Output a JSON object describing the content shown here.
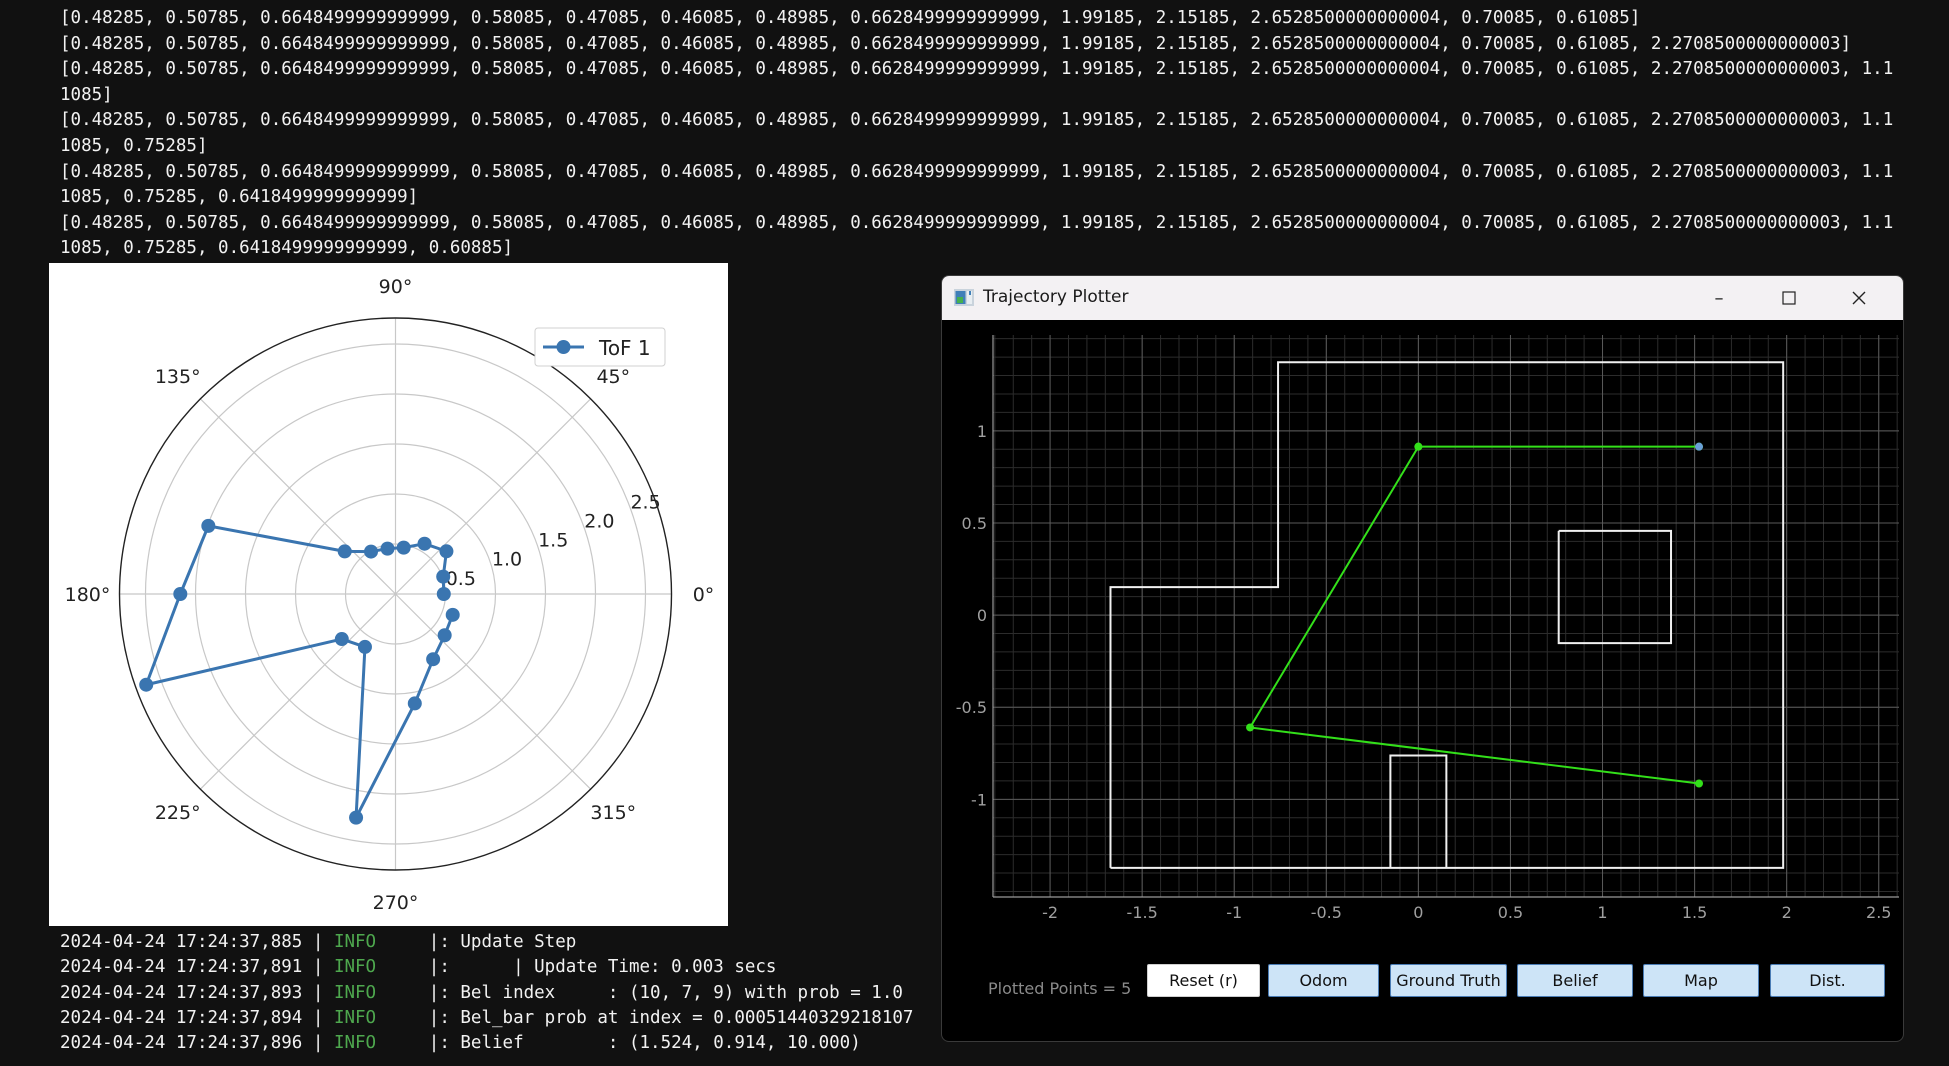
{
  "terminal": {
    "array_lines": [
      "[0.48285, 0.50785, 0.6648499999999999, 0.58085, 0.47085, 0.46085, 0.48985, 0.6628499999999999, 1.99185, 2.15185, 2.6528500000000004, 0.70085, 0.61085]",
      "[0.48285, 0.50785, 0.6648499999999999, 0.58085, 0.47085, 0.46085, 0.48985, 0.6628499999999999, 1.99185, 2.15185, 2.6528500000000004, 0.70085, 0.61085, 2.2708500000000003]",
      "[0.48285, 0.50785, 0.6648499999999999, 0.58085, 0.47085, 0.46085, 0.48985, 0.6628499999999999, 1.99185, 2.15185, 2.6528500000000004, 0.70085, 0.61085, 2.2708500000000003, 1.1",
      "1085]",
      "[0.48285, 0.50785, 0.6648499999999999, 0.58085, 0.47085, 0.46085, 0.48985, 0.6628499999999999, 1.99185, 2.15185, 2.6528500000000004, 0.70085, 0.61085, 2.2708500000000003, 1.1",
      "1085, 0.75285]",
      "[0.48285, 0.50785, 0.6648499999999999, 0.58085, 0.47085, 0.46085, 0.48985, 0.6628499999999999, 1.99185, 2.15185, 2.6528500000000004, 0.70085, 0.61085, 2.2708500000000003, 1.1",
      "1085, 0.75285, 0.6418499999999999]",
      "[0.48285, 0.50785, 0.6648499999999999, 0.58085, 0.47085, 0.46085, 0.48985, 0.6628499999999999, 1.99185, 2.15185, 2.6528500000000004, 0.70085, 0.61085, 2.2708500000000003, 1.1",
      "1085, 0.75285, 0.6418499999999999, 0.60885]"
    ],
    "log": [
      {
        "timestamp": "2024-04-24 17:24:37,885",
        "level": "INFO",
        "message": ": Update Step"
      },
      {
        "timestamp": "2024-04-24 17:24:37,891",
        "level": "INFO",
        "message": ":      | Update Time: 0.003 secs"
      },
      {
        "timestamp": "2024-04-24 17:24:37,893",
        "level": "INFO",
        "message": ": Bel index     : (10, 7, 9) with prob = 1.0"
      },
      {
        "timestamp": "2024-04-24 17:24:37,894",
        "level": "INFO",
        "message": ": Bel_bar prob at index = 0.00051440329218107"
      },
      {
        "timestamp": "2024-04-24 17:24:37,896",
        "level": "INFO",
        "message": ": Belief        : (1.524, 0.914, 10.000)"
      }
    ],
    "colors": {
      "level_info": "#4ea84e",
      "text": "#f2f2f2",
      "background": "#111111"
    }
  },
  "chart_data": [
    {
      "type": "line",
      "projection": "polar",
      "title": "",
      "legend": {
        "entries": [
          "ToF 1"
        ],
        "placement": "top-right"
      },
      "series": [
        {
          "name": "ToF 1",
          "color": "#3a75b0",
          "marker": "circle",
          "theta_deg": [
            0,
            20,
            40,
            60,
            80,
            100,
            120,
            140,
            160,
            180,
            200,
            220,
            240,
            260,
            280,
            300,
            320,
            340
          ],
          "r": [
            0.48285,
            0.50785,
            0.66485,
            0.58085,
            0.47085,
            0.46085,
            0.48985,
            0.66285,
            1.99185,
            2.15185,
            2.65285,
            0.70085,
            0.61085,
            2.27085,
            1.11085,
            0.75285,
            0.64185,
            0.60885
          ]
        }
      ],
      "theta_tick_labels": [
        "0°",
        "45°",
        "90°",
        "135°",
        "180°",
        "225°",
        "270°",
        "315°"
      ],
      "theta_ticks_deg": [
        0,
        45,
        90,
        135,
        180,
        225,
        270,
        315
      ],
      "r_ticks": [
        0.5,
        1.0,
        1.5,
        2.0,
        2.5
      ],
      "r_tick_labels": [
        "0.5",
        "1.0",
        "1.5",
        "2.0",
        "2.5"
      ],
      "rlim": [
        0,
        2.76
      ],
      "r_label_angle_deg": 22.5,
      "grid": true
    },
    {
      "type": "line",
      "title": "Trajectory Plotter",
      "xlim": [
        -2.31,
        2.61
      ],
      "ylim": [
        -1.53,
        1.52
      ],
      "x_ticks": [
        -2,
        -1.5,
        -1,
        -0.5,
        0,
        0.5,
        1,
        1.5,
        2,
        2.5
      ],
      "x_tick_labels": [
        "-2",
        "-1.5",
        "-1",
        "-0.5",
        "0",
        "0.5",
        "1",
        "1.5",
        "2",
        "2.5"
      ],
      "y_ticks": [
        -1,
        -0.5,
        0,
        0.5,
        1
      ],
      "y_tick_labels": [
        "-1",
        "-0.5",
        "0",
        "0.5",
        "1"
      ],
      "minor_step": 0.1,
      "grid": true,
      "series": [
        {
          "name": "Odom",
          "color": "#33e01a",
          "x": [
            1.524,
            -0.914,
            0.0
          ],
          "y": [
            -0.914,
            -0.61,
            0.914
          ]
        },
        {
          "name": "Odom-last-segment",
          "color": "#33e01a",
          "x": [
            0.0,
            1.524
          ],
          "y": [
            0.914,
            0.914
          ]
        },
        {
          "name": "Belief",
          "color": "#6a9fd8",
          "x": [
            1.524
          ],
          "y": [
            0.914
          ]
        }
      ],
      "map_walls": [
        {
          "name": "outer-boundary",
          "x": [
            -1.672,
            -1.672,
            -0.762,
            -0.762,
            1.981,
            1.981,
            -1.672
          ],
          "y": [
            -1.372,
            0.152,
            0.152,
            1.372,
            1.372,
            -1.372,
            -1.372
          ]
        },
        {
          "name": "box-obstacle",
          "x": [
            0.762,
            1.372,
            1.372,
            0.762,
            0.762
          ],
          "y": [
            0.457,
            0.457,
            -0.152,
            -0.152,
            0.457
          ]
        },
        {
          "name": "bottom-obstacle",
          "x": [
            -0.152,
            -0.152,
            0.152,
            0.152
          ],
          "y": [
            -1.372,
            -0.762,
            -0.762,
            -1.372
          ]
        }
      ],
      "wall_color": "#f0f0f0"
    }
  ],
  "plotter": {
    "title": "Trajectory Plotter",
    "window_controls": {
      "minimize": "–",
      "maximize": "☐",
      "close": "✕"
    },
    "plotted_points_label": "Plotted Points = 5",
    "buttons": [
      {
        "label": "Reset (r)",
        "id": "reset"
      },
      {
        "label": "Odom",
        "id": "odom"
      },
      {
        "label": "Ground Truth",
        "id": "ground-truth"
      },
      {
        "label": "Belief",
        "id": "belief"
      },
      {
        "label": "Map",
        "id": "map"
      },
      {
        "label": "Dist.",
        "id": "dist"
      }
    ]
  }
}
